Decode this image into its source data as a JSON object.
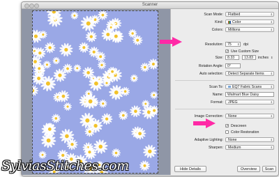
{
  "window": {
    "title": "Scanner"
  },
  "watermark": {
    "text": "SylviasStitches.com"
  },
  "settings": {
    "scan_mode": {
      "label": "Scan Mode:",
      "value": "Flatbed"
    },
    "kind": {
      "label": "Kind:",
      "value": "Color"
    },
    "colors": {
      "label": "Colors:",
      "value": "Millions"
    },
    "resolution": {
      "label": "Resolution:",
      "value": "75",
      "unit": "dpi"
    },
    "use_custom_size": {
      "label": "Use Custom Size",
      "checked": true
    },
    "size": {
      "label": "Size:",
      "width": "8.33",
      "height": "13.83",
      "unit": "inches"
    },
    "rotation_angle": {
      "label": "Rotation Angle:",
      "value": "0°"
    },
    "auto_selection": {
      "label": "Auto selection:",
      "value": "Detect Separate Items"
    },
    "scan_to": {
      "label": "Scan To:",
      "value": "EQ7 Fabric Scans"
    },
    "name": {
      "label": "Name:",
      "value": "Walmart Blue Daisy"
    },
    "format": {
      "label": "Format:",
      "value": "JPEG"
    },
    "image_correction": {
      "label": "Image Correction:",
      "value": "None"
    },
    "descreen": {
      "label": "Descreen",
      "checked": true
    },
    "color_restoration": {
      "label": "Color Restoration",
      "checked": false
    },
    "adaptive_lighting": {
      "label": "Adaptive Lighting:",
      "value": "None"
    },
    "sharpen": {
      "label": "Sharpen:",
      "value": "Medium"
    }
  },
  "buttons": {
    "hide_details": "Hide Details",
    "overview": "Overview",
    "scan": "Scan"
  },
  "colors": {
    "annotation_arrow": "#ff2aa6",
    "fabric": "#9aa8e6",
    "petal": "#ffffff",
    "center": "#f2c22a"
  }
}
